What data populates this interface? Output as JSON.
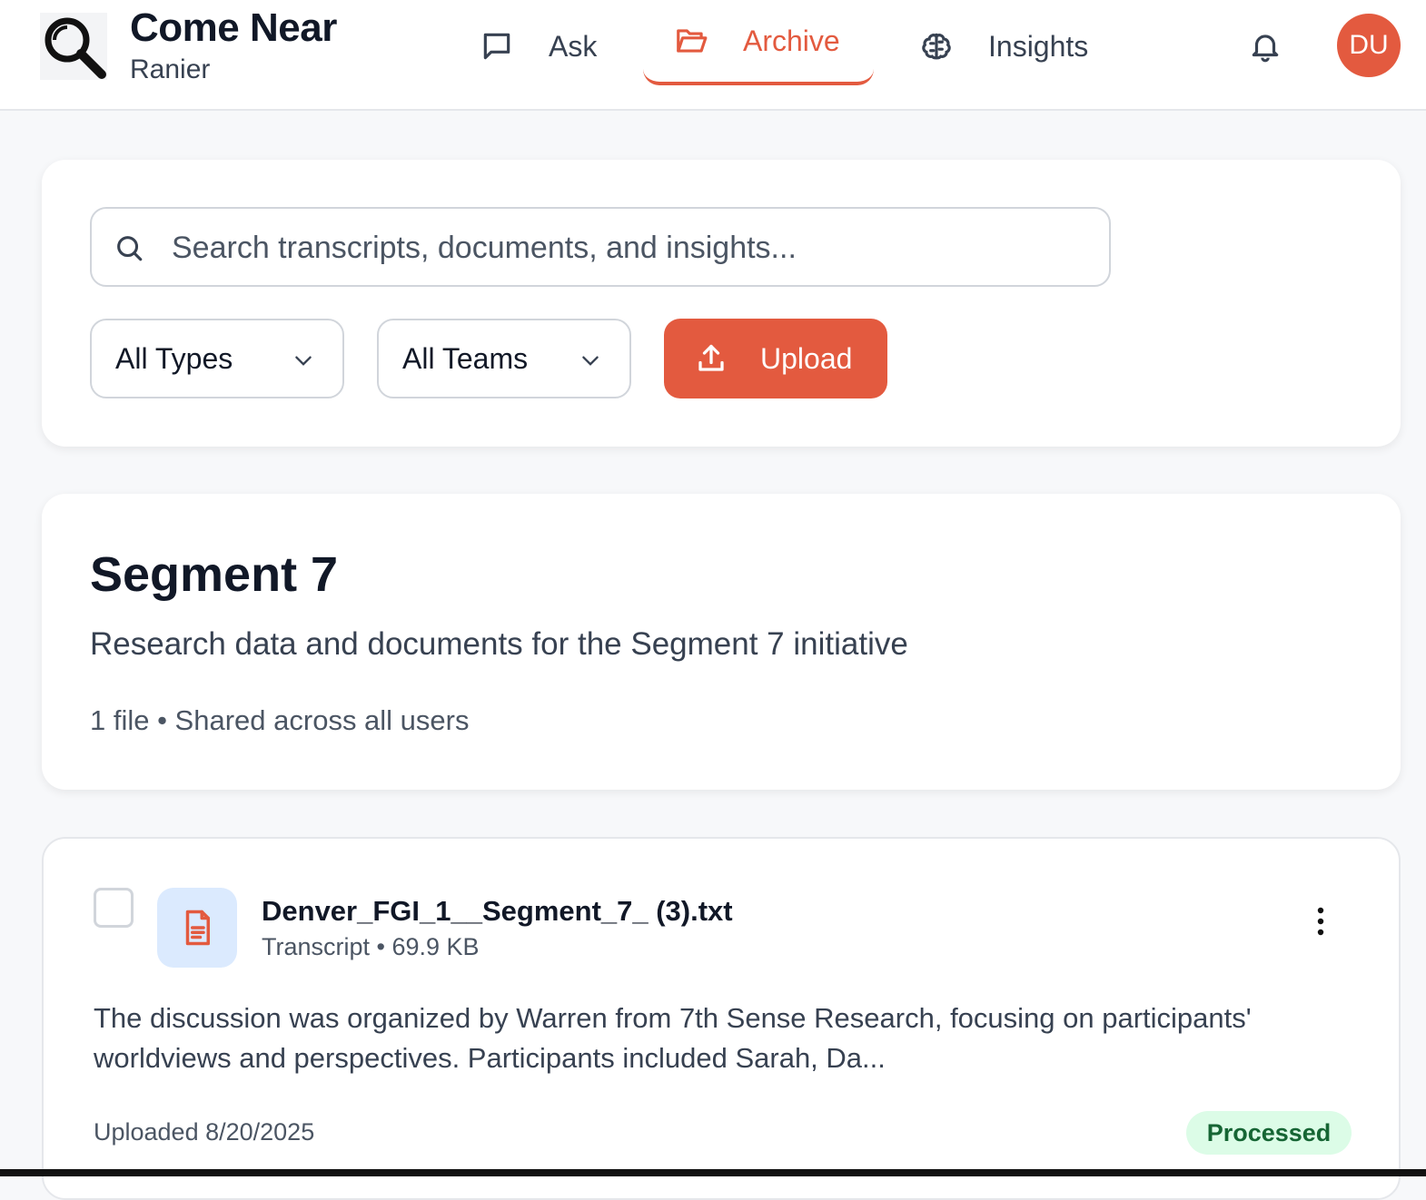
{
  "brand": {
    "title": "Come Near",
    "subtitle": "Ranier"
  },
  "nav": [
    {
      "label": "Ask",
      "icon": "message-square-icon",
      "active": false
    },
    {
      "label": "Archive",
      "icon": "folder-open-icon",
      "active": true
    },
    {
      "label": "Insights",
      "icon": "brain-icon",
      "active": false
    }
  ],
  "header": {
    "notification_icon": "bell-icon",
    "avatar_initials": "DU",
    "accent": "#e35a3f"
  },
  "search": {
    "placeholder": "Search transcripts, documents, and insights...",
    "value": ""
  },
  "filters": {
    "type": "All Types",
    "team": "All Teams"
  },
  "upload": {
    "label": "Upload"
  },
  "segment": {
    "title": "Segment 7",
    "description": "Research data and documents for the Segment 7 initiative",
    "meta": "1 file • Shared across all users"
  },
  "files": [
    {
      "name": "Denver_FGI_1__Segment_7_ (3).txt",
      "meta": "Transcript • 69.9 KB",
      "summary": "The discussion was organized by Warren from 7th Sense Research, focusing on participants' worldviews and perspectives. Participants included Sarah, Da...",
      "uploaded": "Uploaded 8/20/2025",
      "status": "Processed",
      "checked": false
    }
  ]
}
